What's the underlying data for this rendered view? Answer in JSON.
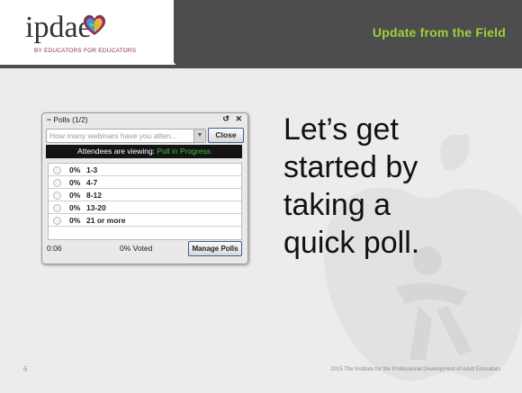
{
  "header": {
    "logo_word": "ipdae",
    "logo_tagline": "BY EDUCATORS FOR EDUCATORS",
    "title": "Update from the Field"
  },
  "poll": {
    "title": "Polls (1/2)",
    "question_placeholder": "How many webinars have you atten...",
    "close_label": "Close",
    "viewing_prefix": "Attendees are viewing:",
    "viewing_status": "Poll in Progress",
    "options": [
      {
        "pct": "0%",
        "label": "1-3",
        "value": 0
      },
      {
        "pct": "0%",
        "label": "4-7",
        "value": 0
      },
      {
        "pct": "0%",
        "label": "8-12",
        "value": 0
      },
      {
        "pct": "0%",
        "label": "13-20",
        "value": 0
      },
      {
        "pct": "0%",
        "label": "21 or more",
        "value": 0
      }
    ],
    "timer": "0:06",
    "voted": "0% Voted",
    "manage_label": "Manage Polls"
  },
  "main_text": [
    "Let’s get",
    "started by",
    "taking a",
    "quick poll."
  ],
  "footer": {
    "page_number": "6",
    "note": "2015 The Institute for the Professional Development of Adult Educators"
  },
  "colors": {
    "accent_green": "#9fd03a",
    "header_gray": "#4d4d4d",
    "status_green": "#3fbf3f"
  }
}
